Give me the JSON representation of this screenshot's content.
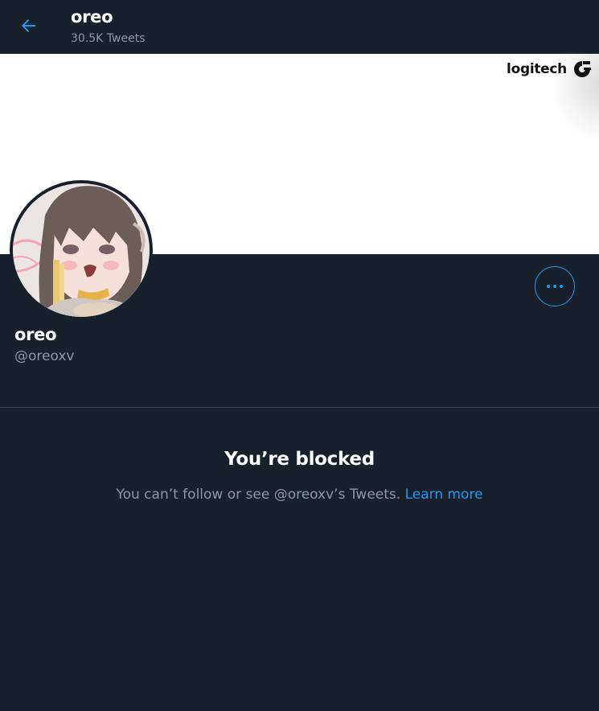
{
  "header": {
    "title": "oreo",
    "tweet_count": "30.5K Tweets"
  },
  "banner": {
    "logo_text": "logitech",
    "background": "#ffffff"
  },
  "profile": {
    "name": "oreo",
    "handle": "@oreoxv"
  },
  "blocked": {
    "title": "You’re blocked",
    "message": "You can’t follow or see @oreoxv’s Tweets.",
    "link": "Learn more"
  },
  "colors": {
    "background": "#17202b",
    "accent": "#1d9bf0",
    "muted_text": "#8b98a5"
  },
  "icons": {
    "back": "arrow-left-icon",
    "more": "more-horizontal-icon"
  }
}
